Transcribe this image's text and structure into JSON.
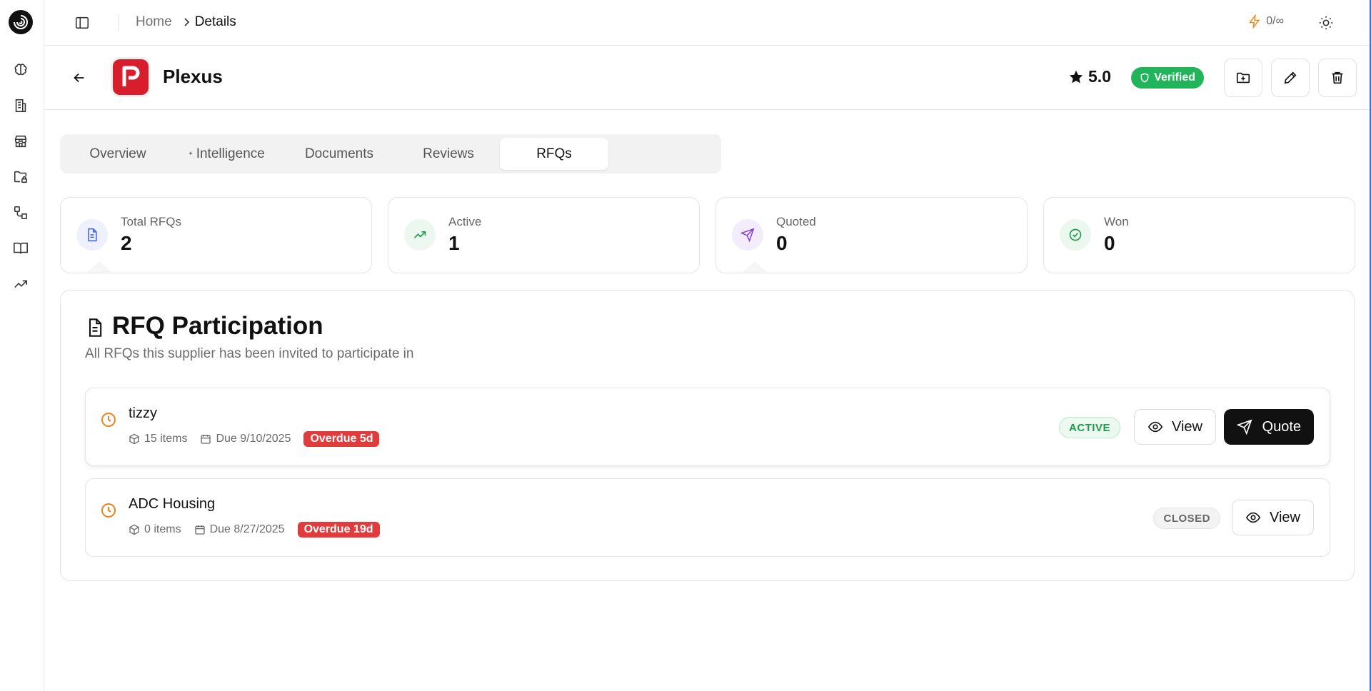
{
  "breadcrumb": {
    "home": "Home",
    "current": "Details"
  },
  "credits": {
    "value": "0/∞"
  },
  "company": {
    "name": "Plexus",
    "rating": "5.0",
    "verified_label": "Verified"
  },
  "tabs": [
    {
      "label": "Overview"
    },
    {
      "label": "Intelligence"
    },
    {
      "label": "Documents"
    },
    {
      "label": "Reviews"
    },
    {
      "label": "RFQs"
    }
  ],
  "active_tab": "RFQs",
  "stats": [
    {
      "label": "Total RFQs",
      "value": "2",
      "icon": "document-icon",
      "color": "#3b5fe0"
    },
    {
      "label": "Active",
      "value": "1",
      "icon": "trending-up-icon",
      "color": "#1e9b4c"
    },
    {
      "label": "Quoted",
      "value": "0",
      "icon": "send-icon",
      "color": "#8a3fd6"
    },
    {
      "label": "Won",
      "value": "0",
      "icon": "check-circle-icon",
      "color": "#1e9b4c"
    }
  ],
  "participation": {
    "title": "RFQ Participation",
    "subtitle": "All RFQs this supplier has been invited to participate in",
    "rows": [
      {
        "name": "tizzy",
        "items": "15 items",
        "due": "Due 9/10/2025",
        "overdue": "Overdue 5d",
        "status": "ACTIVE",
        "view_label": "View",
        "quote_label": "Quote"
      },
      {
        "name": "ADC Housing",
        "items": "0 items",
        "due": "Due 8/27/2025",
        "overdue": "Overdue 19d",
        "status": "CLOSED",
        "view_label": "View"
      }
    ]
  },
  "colors": {
    "brand_red": "#d81e2c",
    "verified_green": "#21b45a",
    "overdue_red": "#e23b3b",
    "clock_orange": "#e8861f",
    "credit_orange": "#f08a1c"
  }
}
